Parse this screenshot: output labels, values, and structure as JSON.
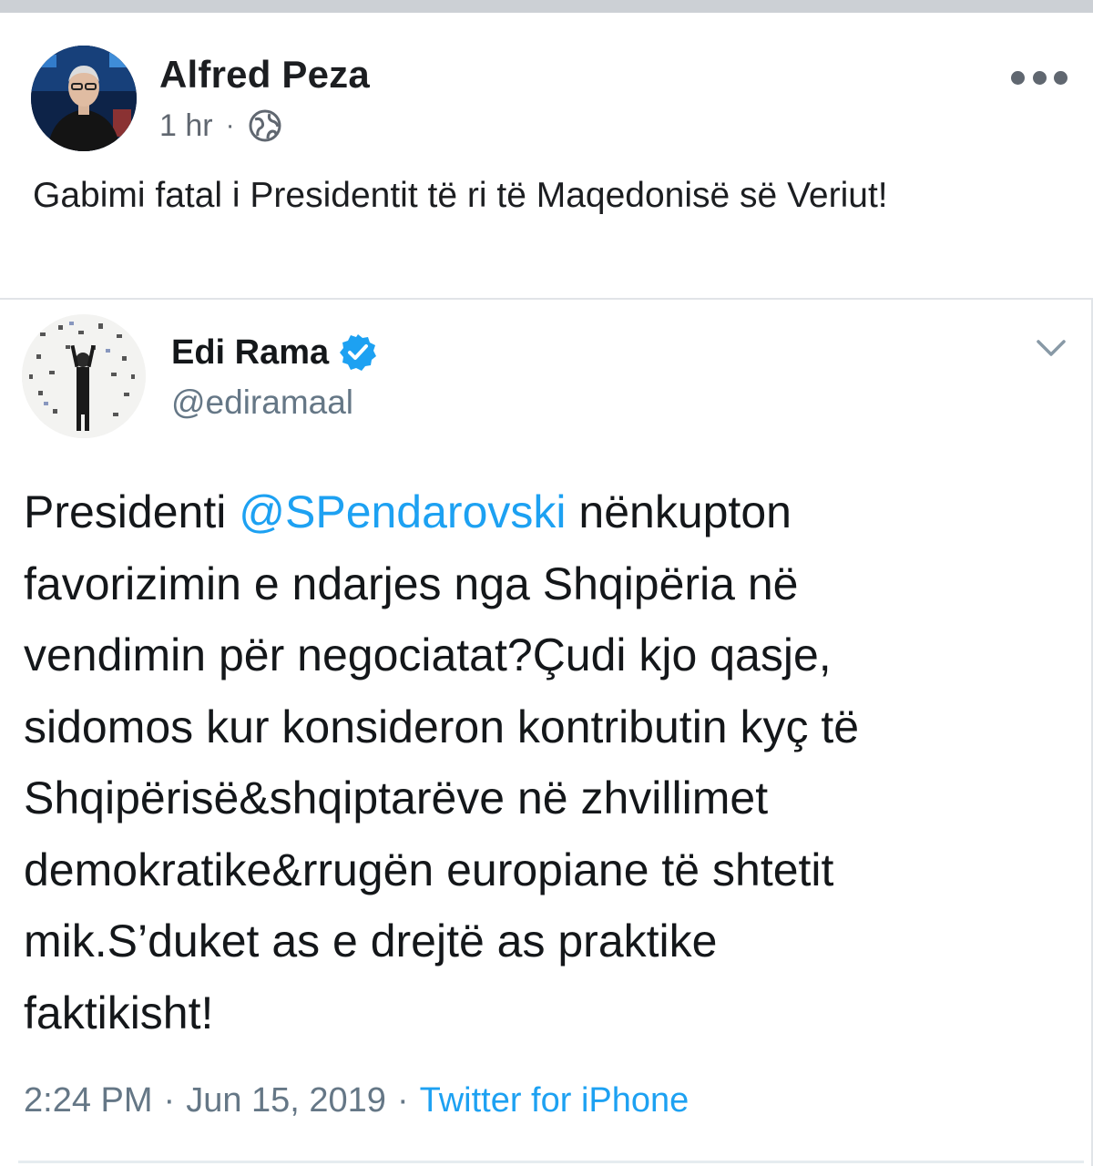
{
  "post": {
    "author_name": "Alfred Peza",
    "time": "1 hr",
    "separator": "·",
    "privacy_icon": "globe-icon",
    "more_icon": "more-options-icon",
    "text": "Gabimi fatal i Presidentit të ri të Maqedonisë së Veriut!"
  },
  "tweet": {
    "display_name": "Edi Rama",
    "verified_icon": "verified-badge-icon",
    "handle": "@ediramaal",
    "menu_icon": "chevron-down-icon",
    "text_before_mention": "Presidenti ",
    "mention": "@SPendarovski",
    "text_after_mention": " nënkupton\nfavorizimin e ndarjes nga Shqipëria në\nvendimin për negociatat?Çudi kjo qasje,\nsidomos kur konsideron kontributin kyç të\nShqipërisë&shqiptarëve në zhvillimet\ndemokratike&rrugën europiane të shtetit\nmik.S’duket as e drejtë as praktike\nfaktikisht!",
    "time": "2:24 PM",
    "date": "Jun 15, 2019",
    "separator": "·",
    "source": "Twitter for iPhone"
  },
  "colors": {
    "link_blue": "#1da1f2",
    "verified_blue": "#1da1f2",
    "meta_gray": "#606770",
    "handle_gray": "#657786"
  }
}
